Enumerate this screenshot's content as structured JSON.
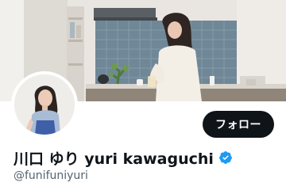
{
  "profile": {
    "display_name": "川口 ゆり yuri kawaguchi",
    "handle": "@funifuniyuri",
    "verified": true,
    "follow_label": "フォロー"
  },
  "colors": {
    "follow_button_bg": "#0f1419",
    "follow_button_text": "#ffffff",
    "verified_badge": "#1d9bf0",
    "handle_text": "#536471"
  },
  "icons": {
    "verified": "verified-badge-icon"
  }
}
